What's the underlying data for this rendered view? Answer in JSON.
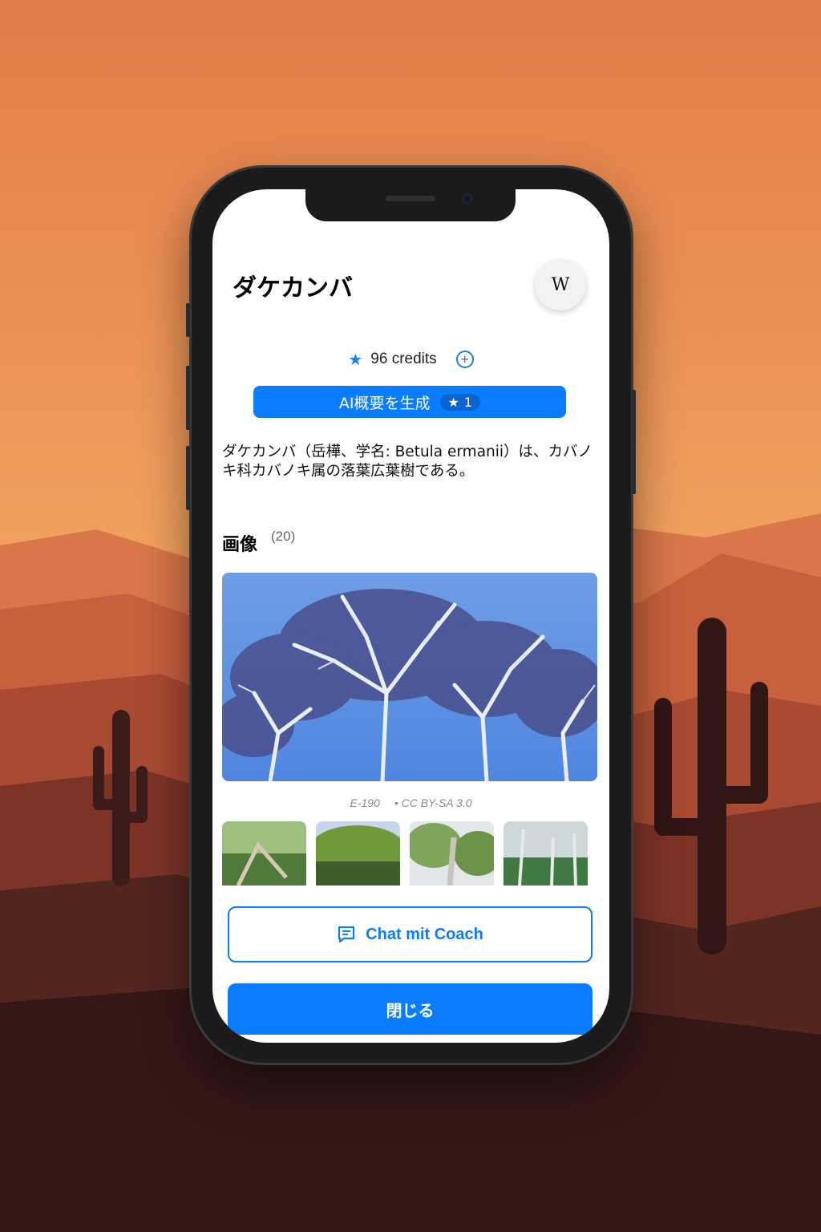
{
  "app": {
    "title": "ダケカンバ",
    "wiki_button_icon": "wikipedia-icon",
    "wiki_button_label": "W"
  },
  "credits": {
    "star_icon": "star-icon",
    "text": "96 credits",
    "add_icon": "plus-circle-icon"
  },
  "ai_summary_button": {
    "label": "AI概要を生成",
    "cost": "1"
  },
  "summary": {
    "text": "ダケカンバ（岳樺、学名: Betula ermanii）は、カバノキ科カバノキ属の落葉広葉樹である。"
  },
  "images_section": {
    "title": "画像",
    "count": "(20)",
    "main_caption_author": "E-190",
    "main_caption_license": "• CC BY-SA 3.0",
    "thumbnail_count": 4
  },
  "actions": {
    "chat_label": "Chat mit Coach",
    "chat_icon": "chat-bubble-icon",
    "close_label": "閉じる"
  },
  "colors": {
    "accent": "#0a7cff",
    "background_sky": "#e8844c"
  }
}
